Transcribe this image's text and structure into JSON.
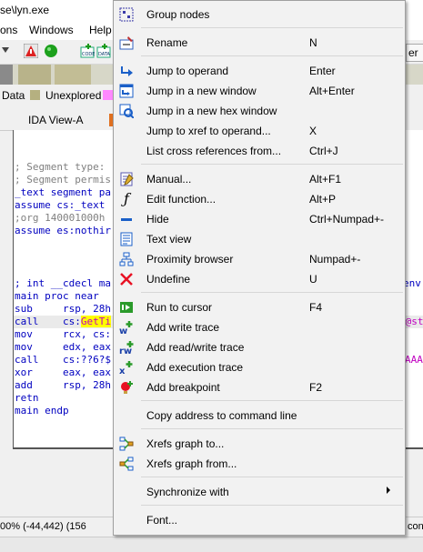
{
  "window": {
    "title": "se\\lyn.exe"
  },
  "menubar": {
    "items": [
      "ons",
      "Windows",
      "Help"
    ]
  },
  "toolbar": {
    "right_label": "er"
  },
  "legend": {
    "data": "Data",
    "unexplored": "Unexplored"
  },
  "tabs": {
    "ida_view": "IDA View-A"
  },
  "code": {
    "line1": "; Segment type:",
    "line2": "; Segment permis",
    "line3": "_text segment pa",
    "line4": "assume cs:_text",
    "line5": ";org 140001000h",
    "line6": "assume es:nothir",
    "line7": "; int __cdecl ma",
    "line7_right": "env",
    "line8": "main proc near",
    "line9a": "sub     rsp, 28h",
    "line10a": "call    cs:",
    "line10b": "GetTi",
    "line10c": "D@st",
    "line11a": "mov     rcx, cs:",
    "line12a": "mov     edx, eax",
    "line13a": "call    cs:??6?$",
    "line13c": "AAA",
    "line14a": "xor     eax, eax",
    "line15a": "add     rsp, 28h",
    "line16a": "retn",
    "line17a": "main endp"
  },
  "status": {
    "left": "00% (-44,442) (156",
    "right": "con"
  },
  "menu": {
    "items": [
      {
        "label": "Group nodes",
        "shortcut": "",
        "icon": "group-nodes-icon"
      },
      {
        "label": "Rename",
        "shortcut": "N",
        "icon": "rename-icon"
      },
      {
        "label": "Jump to operand",
        "shortcut": "Enter",
        "icon": "jump-operand-icon"
      },
      {
        "label": "Jump in a new window",
        "shortcut": "Alt+Enter",
        "icon": "new-window-icon"
      },
      {
        "label": "Jump in a new hex window",
        "shortcut": "",
        "icon": "hex-window-icon"
      },
      {
        "label": "Jump to xref to operand...",
        "shortcut": "X",
        "icon": ""
      },
      {
        "label": "List cross references from...",
        "shortcut": "Ctrl+J",
        "icon": ""
      },
      {
        "label": "Manual...",
        "shortcut": "Alt+F1",
        "icon": "manual-icon"
      },
      {
        "label": "Edit function...",
        "shortcut": "Alt+P",
        "icon": "function-icon"
      },
      {
        "label": "Hide",
        "shortcut": "Ctrl+Numpad+-",
        "icon": "hide-icon"
      },
      {
        "label": "Text view",
        "shortcut": "",
        "icon": "text-view-icon"
      },
      {
        "label": "Proximity browser",
        "shortcut": "Numpad+-",
        "icon": "proximity-icon"
      },
      {
        "label": "Undefine",
        "shortcut": "U",
        "icon": "undefine-icon"
      },
      {
        "label": "Run to cursor",
        "shortcut": "F4",
        "icon": "run-cursor-icon"
      },
      {
        "label": "Add write trace",
        "shortcut": "",
        "icon": "write-trace-icon"
      },
      {
        "label": "Add read/write trace",
        "shortcut": "",
        "icon": "rw-trace-icon"
      },
      {
        "label": "Add execution trace",
        "shortcut": "",
        "icon": "exec-trace-icon"
      },
      {
        "label": "Add breakpoint",
        "shortcut": "F2",
        "icon": "breakpoint-icon"
      },
      {
        "label": "Copy address to command line",
        "shortcut": "",
        "icon": ""
      },
      {
        "label": "Xrefs graph to...",
        "shortcut": "",
        "icon": "xrefs-to-icon"
      },
      {
        "label": "Xrefs graph from...",
        "shortcut": "",
        "icon": "xrefs-from-icon"
      },
      {
        "label": "Synchronize with",
        "shortcut": "",
        "icon": ""
      },
      {
        "label": "Font...",
        "shortcut": "",
        "icon": ""
      }
    ]
  },
  "colors": {
    "accent": "#0078d7",
    "code_blue": "#0000c0",
    "trace_green": "#2a9a2a",
    "undefine_red": "#e81123"
  }
}
